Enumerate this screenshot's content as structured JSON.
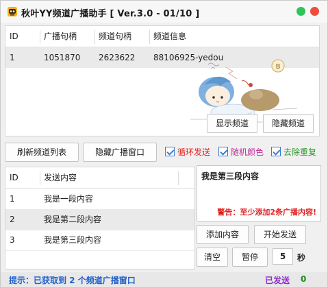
{
  "window": {
    "title": "秋叶YY频道广播助手 [ Ver.3.0 - 01/10 ]",
    "accent": "#3a7bd5",
    "min_color": "#2fc455",
    "close_color": "#f04c3e"
  },
  "channel_table": {
    "headers": [
      "ID",
      "广播句柄",
      "频道句柄",
      "频道信息"
    ],
    "rows": [
      [
        "1",
        "1051870",
        "2623622",
        "88106925-yedou"
      ]
    ]
  },
  "channel_buttons": {
    "show": "显示频道",
    "hide": "隐藏频道"
  },
  "controls": {
    "refresh": "刷新频道列表",
    "hide_window": "隐藏广播窗口",
    "loop_send": "循环发送",
    "random_color": "随机颜色",
    "dedupe": "去除重复"
  },
  "message_table": {
    "headers": [
      "ID",
      "发送内容"
    ],
    "rows": [
      [
        "1",
        "我是一段内容"
      ],
      [
        "2",
        "我是第二段内容"
      ],
      [
        "3",
        "我是第三段内容"
      ]
    ]
  },
  "editor": {
    "text": "我是第三段内容",
    "warning": "警告：至少添加2条广播内容!"
  },
  "actions": {
    "add": "添加内容",
    "start": "开始发送",
    "clear": "清空",
    "pause": "暂停",
    "interval_value": "5",
    "interval_unit": "秒"
  },
  "status": {
    "message": "提示：已获取到 2 个频道广播窗口",
    "sent_label": "已发送",
    "sent_count": "0"
  },
  "mascot": {
    "caption": "B"
  }
}
